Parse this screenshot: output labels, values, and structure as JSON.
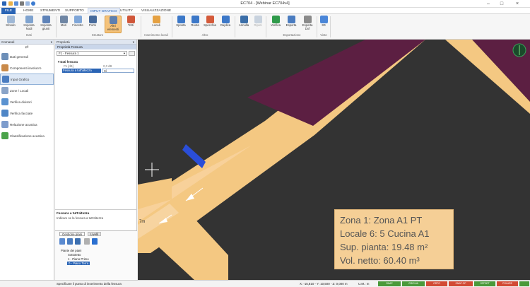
{
  "window": {
    "title": "EC704 - [Webinar EC704v4]"
  },
  "menu": {
    "items": [
      "FILE",
      "HOME",
      "STRUMENTI",
      "SUPPORTO",
      "INPUT GRAFICO",
      "UTILITY",
      "VISUALIZZAZIONE"
    ]
  },
  "ribbon": {
    "buttons": {
      "sfondo": "Sfondo",
      "imposta_nodi": "Imposta Nodi",
      "imposta_giunti": "Imposta giunti",
      "muri": "Muri",
      "finestre": "Finestre",
      "porte": "Porte",
      "altri_elementi": "Altri elementi",
      "tetti": "Tetti",
      "locali": "Locali",
      "sposta": "Sposta",
      "ruota": "Ruota",
      "specchia": "Specchia",
      "duplica": "Duplica",
      "annulla": "Annulla",
      "ripeti": "Ripeti",
      "verifica": "Verifica",
      "esporta": "Esporta",
      "esporta_dxf": "Esporta Dxf",
      "view3d": "3D"
    },
    "groups": {
      "dati": "Dati",
      "strutture": "Strutture",
      "inserimento_locali": "Inserimento locali",
      "altro": "Altro",
      "esportazione": "Esportazione",
      "viste": "Viste"
    }
  },
  "left_panel": {
    "title": "Comandi",
    "items": [
      "Dati generali",
      "Componenti involucro",
      "Input Grafico",
      "Zone / Locali",
      "Verifica divisori",
      "Verifica facciate",
      "Relazione acustica",
      "Classificazione acustica"
    ]
  },
  "props_panel": {
    "title": "Proprietà",
    "subtitle": "Proprietà Fessura",
    "selector": "F1 - Fessura 1",
    "category": "Dati fessura",
    "rows": [
      {
        "label": "Ps [dB]",
        "value": "0,0 dB"
      },
      {
        "label": "Fessura a tutt'altezza",
        "value": "Sì"
      }
    ],
    "desc_title": "Fessura a tutt'altezza",
    "desc_text": "Indicare se la fessura a tutt'altezza",
    "tabs": [
      "Gestione piani",
      "Livelli"
    ],
    "tree": {
      "root": "Piante dei piani",
      "items": [
        "Sottotetto",
        "1 - Piano Primo",
        "0 - Piano Terra"
      ]
    }
  },
  "canvas": {
    "dim_label": "7m",
    "info": {
      "line1": "Zona 1: Zona A1 PT",
      "line2": "Locale 6: 5 Cucina A1",
      "line3": "Sup. pianta: 19.48 m²",
      "line4": "Vol. netto: 60.40 m³"
    }
  },
  "status": {
    "prompt": "Specificare il punto di inserimento della fessura",
    "coords": "X: -15,810 - Y: 10,500 - Z: 0,000 m",
    "unit": "U.M.: m",
    "indicators": [
      "SNAP",
      "GRIGLIA",
      "ORTO",
      "SNAP OP",
      "OFFSET",
      "POLARE",
      "SNAP ANG",
      "LIVELLI"
    ]
  },
  "colors": {
    "accent": "#2a64b5",
    "wall_tan": "#f4c882",
    "wall_purple": "#5c1f42",
    "crack_blue": "#2a4ed8",
    "canvas_bg": "#333333",
    "status_green": "#4a9a3a",
    "status_red": "#d24a34"
  }
}
